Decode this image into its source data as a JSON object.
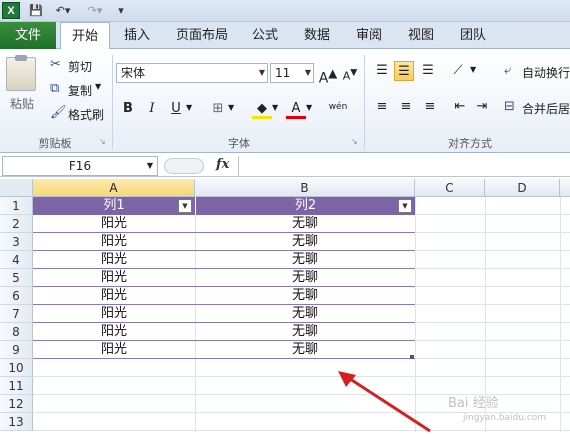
{
  "qat": {
    "excel_logo": "X",
    "save_icon": "floppy-icon",
    "undo_icon": "undo-icon",
    "redo_icon": "redo-icon",
    "customize_icon": "customize-icon"
  },
  "tabs": {
    "file": "文件",
    "items": [
      "开始",
      "插入",
      "页面布局",
      "公式",
      "数据",
      "审阅",
      "视图",
      "团队"
    ],
    "active": "开始"
  },
  "clipboard": {
    "paste": "粘贴",
    "cut": "剪切",
    "copy": "复制",
    "format_painter": "格式刷",
    "group": "剪贴板"
  },
  "font": {
    "name": "宋体",
    "size": "11",
    "grow": "A",
    "shrink": "A",
    "bold": "B",
    "italic": "I",
    "underline": "U",
    "font_color": "A",
    "phonetic": "wén",
    "group": "字体"
  },
  "alignment": {
    "wrap": "自动换行",
    "merge": "合并后居",
    "group": "对齐方式"
  },
  "formula_bar": {
    "name_box": "F16",
    "fx": "fx",
    "value": ""
  },
  "sheet": {
    "columns": [
      "A",
      "B",
      "C",
      "D"
    ],
    "rows": [
      "1",
      "2",
      "3",
      "4",
      "5",
      "6",
      "7",
      "8",
      "9",
      "10",
      "11",
      "12",
      "13"
    ],
    "table_headers": [
      "列1",
      "列2"
    ],
    "table_rows": [
      [
        "阳光",
        "无聊"
      ],
      [
        "阳光",
        "无聊"
      ],
      [
        "阳光",
        "无聊"
      ],
      [
        "阳光",
        "无聊"
      ],
      [
        "阳光",
        "无聊"
      ],
      [
        "阳光",
        "无聊"
      ],
      [
        "阳光",
        "无聊"
      ],
      [
        "阳光",
        "无聊"
      ]
    ]
  },
  "watermark": {
    "line1": "Bai 经验",
    "line2": "jingyan.baidu.com"
  },
  "colors": {
    "table_header": "#7c64a6",
    "file_tab": "#2b7d33",
    "arrow": "#d62020"
  }
}
